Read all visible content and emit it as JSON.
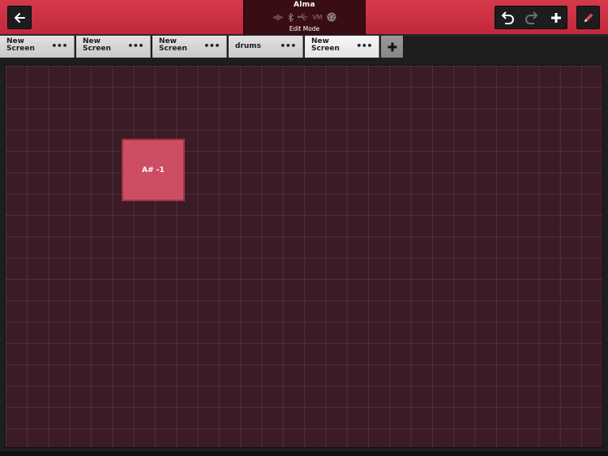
{
  "header": {
    "device_name": "Alma",
    "vm_label": "VM",
    "mode_label": "Edit Mode"
  },
  "tabs": [
    {
      "label": "New\nScreen",
      "menu": "•••"
    },
    {
      "label": "New\nScreen",
      "menu": "•••"
    },
    {
      "label": "New\nScreen",
      "menu": "•••"
    },
    {
      "label": "drums",
      "menu": "•••"
    },
    {
      "label": "New\nScreen",
      "menu": "•••",
      "active": true
    }
  ],
  "pads": [
    {
      "label": "A# -1",
      "color": "#cd4e64"
    }
  ],
  "colors": {
    "accent": "#c92f42",
    "grid_bg": "#3b1c26"
  }
}
